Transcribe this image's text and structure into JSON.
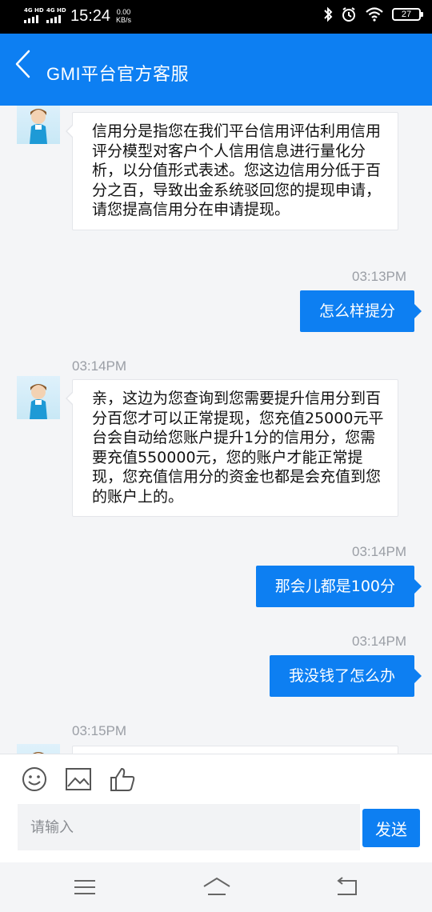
{
  "status_bar": {
    "sim1": "4G HD",
    "sim2": "4G HD",
    "time": "15:24",
    "speed_value": "0.00",
    "speed_unit": "KB/s",
    "battery": "27"
  },
  "header": {
    "title": "GMI平台官方客服",
    "back_icon": "chevron-left-icon"
  },
  "messages": [
    {
      "from": "service",
      "time": "",
      "text": "信用分是指您在我们平台信用评估利用信用评分模型对客户个人信用信息进行量化分析，以分值形式表述。您这边信用分低于百分之百，导致出金系统驳回您的提现申请，请您提高信用分在申请提现。"
    },
    {
      "from": "user",
      "time": "03:13PM",
      "text": "怎么样提分"
    },
    {
      "from": "service",
      "time": "03:14PM",
      "text": "亲，这边为您查询到您需要提升信用分到百分百您才可以正常提现，您充值25000元平台会自动给您账户提升1分的信用分，您需要充值550000元，您的账户才能正常提现，您充值信用分的资金也都是会充值到您的账户上的。"
    },
    {
      "from": "user",
      "time": "03:14PM",
      "text": "那会儿都是100分"
    },
    {
      "from": "user",
      "time": "03:14PM",
      "text": "我没钱了怎么办"
    },
    {
      "from": "service",
      "time": "03:15PM",
      "text": ""
    }
  ],
  "input_bar": {
    "emoji_icon": "emoji-icon",
    "image_icon": "image-icon",
    "like_icon": "thumbs-up-icon",
    "placeholder": "请输入",
    "value": "",
    "send_label": "发送"
  },
  "nav": {
    "menu_icon": "menu-icon",
    "home_icon": "home-icon",
    "back_icon": "back-icon"
  },
  "colors": {
    "accent": "#0d7ff2",
    "status_bar": "#000000",
    "chat_bg": "#f4f5f7",
    "timestamp": "#9a9ea5"
  }
}
